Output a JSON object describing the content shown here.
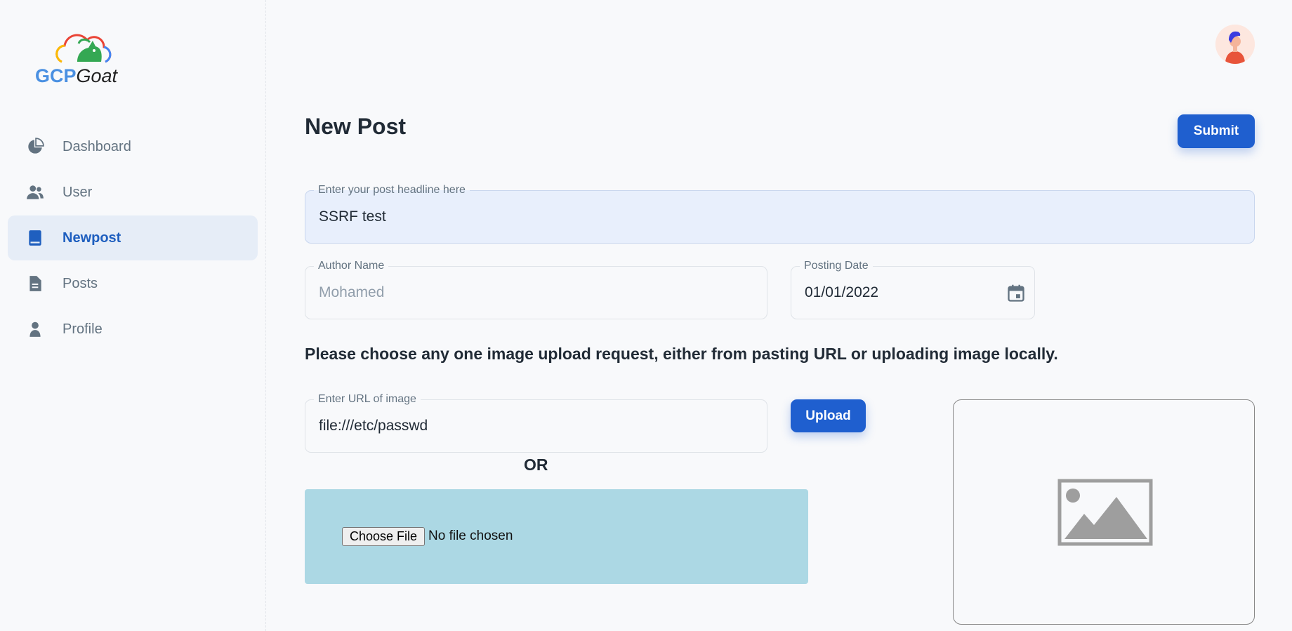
{
  "brand": {
    "part1": "GCP",
    "part2": "Goat"
  },
  "sidebar": {
    "items": [
      {
        "label": "Dashboard",
        "icon": "pie-chart-icon",
        "active": false
      },
      {
        "label": "User",
        "icon": "users-icon",
        "active": false
      },
      {
        "label": "Newpost",
        "icon": "book-icon",
        "active": true
      },
      {
        "label": "Posts",
        "icon": "document-icon",
        "active": false
      },
      {
        "label": "Profile",
        "icon": "person-icon",
        "active": false
      }
    ]
  },
  "header": {
    "avatar_icon": "user-avatar-icon"
  },
  "page": {
    "title": "New Post",
    "submit_label": "Submit",
    "headline": {
      "label": "Enter your post headline here",
      "value": "SSRF test"
    },
    "author": {
      "label": "Author Name",
      "value": "Mohamed"
    },
    "date": {
      "label": "Posting Date",
      "value": "01/01/2022"
    },
    "instructions": "Please choose any one image upload request, either from pasting URL or uploading image locally.",
    "url": {
      "label": "Enter URL of image",
      "value": "file:///etc/passwd"
    },
    "upload_label": "Upload",
    "or_label": "OR",
    "file": {
      "button_label": "Choose File",
      "status": "No file chosen"
    }
  },
  "colors": {
    "accent": "#1f5fcf",
    "active_nav_bg": "#e6edf7",
    "dropzone_bg": "#acd8e4",
    "headline_bg": "#e8effc"
  }
}
